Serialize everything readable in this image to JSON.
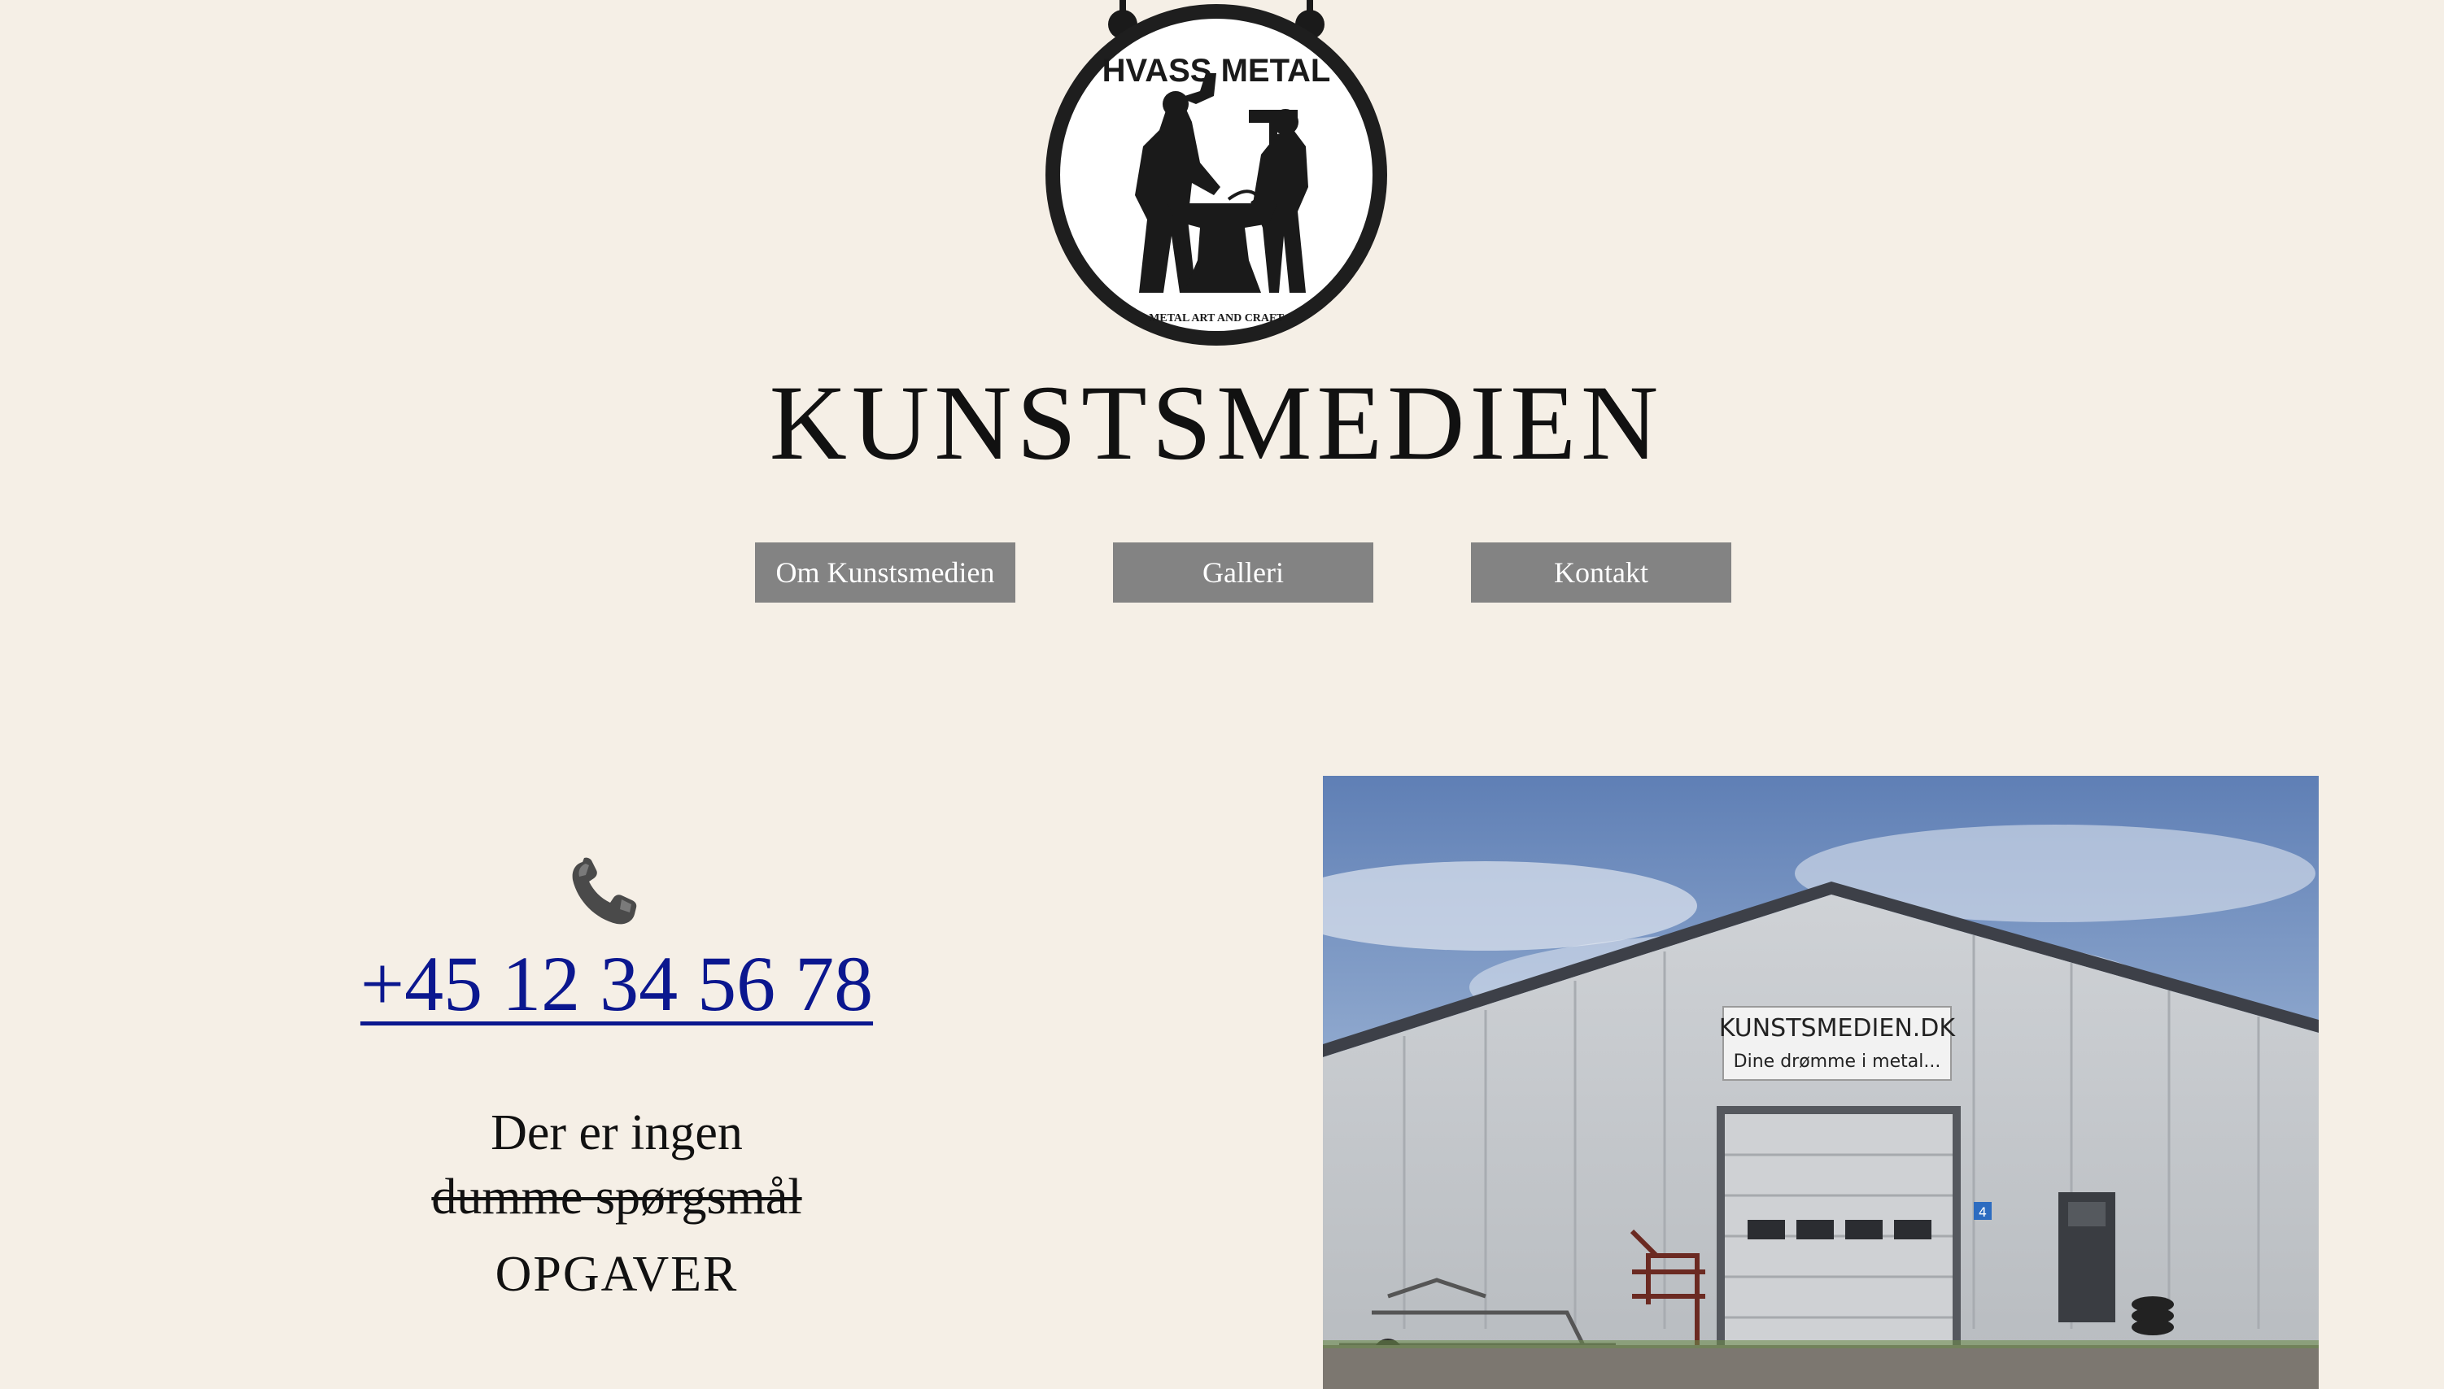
{
  "logo": {
    "brand_text": "HVASS METAL",
    "tagline": "METAL ART AND CRAFT"
  },
  "header": {
    "title": "KUNSTSMEDIEN"
  },
  "nav": {
    "items": [
      {
        "label": "Om Kunstsmedien"
      },
      {
        "label": "Galleri"
      },
      {
        "label": "Kontakt"
      }
    ]
  },
  "contact": {
    "icon": "telephone-icon",
    "phone": "+45 12 34 56 78",
    "slogan_line1": "Der er ingen",
    "slogan_line2_struck": "dumme spørgsmål",
    "slogan_line3": "OPGAVER"
  },
  "photo": {
    "sign_line1": "KUNSTSMEDIEN.DK",
    "sign_line2": "Dine drømme i metal...",
    "door_number": "4"
  },
  "colors": {
    "background": "#f5efe6",
    "nav_button": "#838383",
    "link": "#0b178f"
  }
}
